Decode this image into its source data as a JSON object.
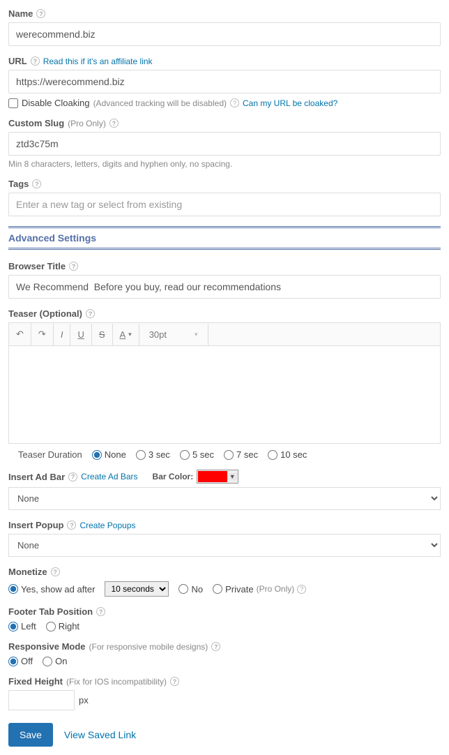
{
  "name": {
    "label": "Name",
    "value": "werecommend.biz"
  },
  "url": {
    "label": "URL",
    "affiliate_link": "Read this if it's an affiliate link",
    "value": "https://werecommend.biz",
    "disable_cloaking": "Disable Cloaking",
    "disable_cloaking_note": "(Advanced tracking will be disabled)",
    "cloak_link": "Can my URL be cloaked?"
  },
  "slug": {
    "label": "Custom Slug",
    "pro": "(Pro Only)",
    "value": "ztd3c75m",
    "hint": "Min 8 characters, letters, digits and hyphen only, no spacing."
  },
  "tags": {
    "label": "Tags",
    "placeholder": "Enter a new tag or select from existing"
  },
  "advanced": {
    "title": "Advanced Settings"
  },
  "browser_title": {
    "label": "Browser Title",
    "value": "We Recommend  Before you buy, read our recommendations"
  },
  "teaser": {
    "label": "Teaser (Optional)",
    "font_size": "30pt",
    "duration_label": "Teaser Duration",
    "options": [
      "None",
      "3 sec",
      "5 sec",
      "7 sec",
      "10 sec"
    ]
  },
  "adbar": {
    "label": "Insert Ad Bar",
    "create_link": "Create Ad Bars",
    "bar_color_label": "Bar Color:",
    "selected": "None"
  },
  "popup": {
    "label": "Insert Popup",
    "create_link": "Create Popups",
    "selected": "None"
  },
  "monetize": {
    "label": "Monetize",
    "yes": "Yes, show ad after",
    "delay": "10 seconds",
    "no": "No",
    "private": "Private",
    "pro": "(Pro Only)"
  },
  "footer_tab": {
    "label": "Footer Tab Position",
    "left": "Left",
    "right": "Right"
  },
  "responsive": {
    "label": "Responsive Mode",
    "note": "(For responsive mobile designs)",
    "off": "Off",
    "on": "On"
  },
  "fixed_height": {
    "label": "Fixed Height",
    "note": "(Fix for IOS incompatibility)",
    "unit": "px"
  },
  "actions": {
    "save": "Save",
    "view": "View Saved Link"
  }
}
